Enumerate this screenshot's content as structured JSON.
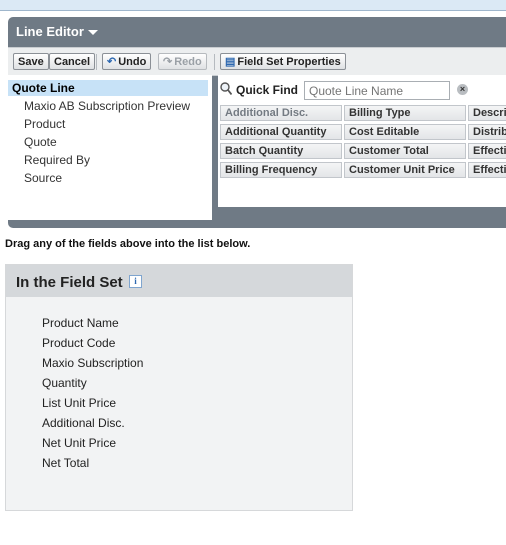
{
  "editor": {
    "title": "Line Editor",
    "toolbar": {
      "save": "Save",
      "cancel": "Cancel",
      "undo": "Undo",
      "redo": "Redo",
      "field_set_properties": "Field Set Properties"
    }
  },
  "left_list": {
    "selected": "Quote Line",
    "items": [
      "Maxio AB Subscription Preview",
      "Product",
      "Quote",
      "Required By",
      "Source"
    ]
  },
  "quick_find": {
    "label": "Quick Find",
    "placeholder": "Quote Line Name"
  },
  "fields_grid": [
    [
      "Additional Disc.",
      "Billing Type",
      "Descrip"
    ],
    [
      "Additional Quantity",
      "Cost Editable",
      "Distribu"
    ],
    [
      "Batch Quantity",
      "Customer Total",
      "Effectiv"
    ],
    [
      "Billing Frequency",
      "Customer Unit Price",
      "Effectiv"
    ]
  ],
  "drag_hint": "Drag any of the fields above into the list below.",
  "field_set": {
    "title": "In the Field Set",
    "info_icon": "i",
    "items": [
      "Product Name",
      "Product Code",
      "Maxio Subscription",
      "Quantity",
      "List Unit Price",
      "Additional Disc.",
      "Net Unit Price",
      "Net Total"
    ]
  }
}
